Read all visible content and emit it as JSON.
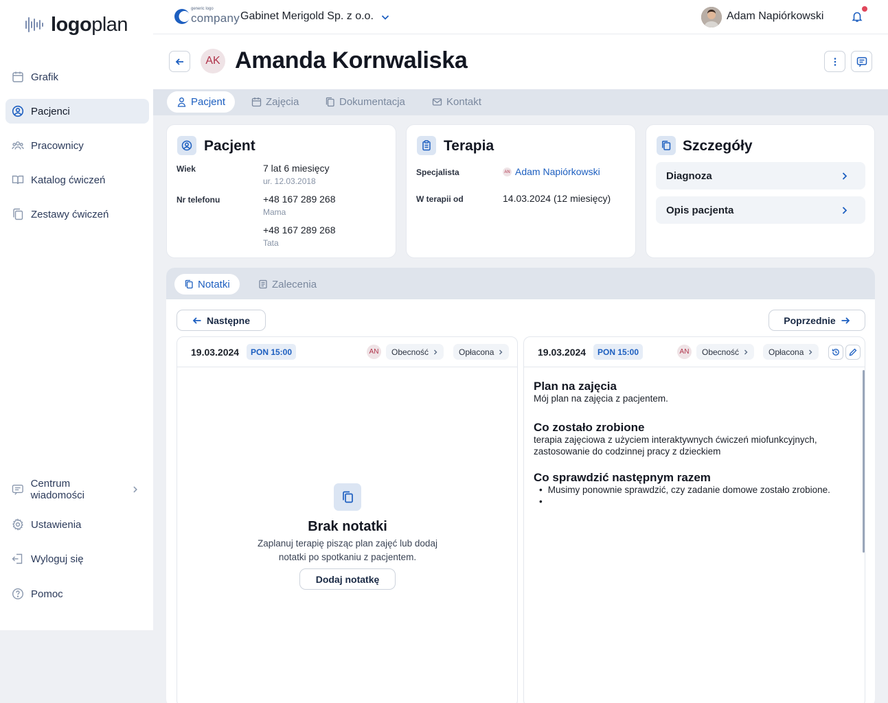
{
  "app": {
    "logo_bold": "logo",
    "logo_light": "plan"
  },
  "sidebar": {
    "items": [
      {
        "label": "Grafik",
        "icon": "calendar-icon"
      },
      {
        "label": "Pacjenci",
        "icon": "user-circle-icon",
        "active": true
      },
      {
        "label": "Pracownicy",
        "icon": "users-icon"
      },
      {
        "label": "Katalog ćwiczeń",
        "icon": "book-icon"
      },
      {
        "label": "Zestawy ćwiczeń",
        "icon": "copy-icon"
      }
    ],
    "bottom": [
      {
        "label": "Centrum wiadomości",
        "icon": "message-icon"
      },
      {
        "label": "Ustawienia",
        "icon": "gear-icon"
      },
      {
        "label": "Wyloguj się",
        "icon": "logout-icon"
      },
      {
        "label": "Pomoc",
        "icon": "help-icon"
      }
    ]
  },
  "topbar": {
    "company_logo_small": "generic logo",
    "company_logo_text": "company",
    "company_name": "Gabinet Merigold Sp. z o.o.",
    "user_name": "Adam Napiórkowski"
  },
  "header": {
    "patient_initials": "AK",
    "patient_name": "Amanda Kornwaliska"
  },
  "tabs": [
    {
      "label": "Pacjent",
      "active": true
    },
    {
      "label": "Zajęcia"
    },
    {
      "label": "Dokumentacja"
    },
    {
      "label": "Kontakt"
    }
  ],
  "patient_card": {
    "title": "Pacjent",
    "age_label": "Wiek",
    "age_value": "7 lat  6 miesięcy",
    "birth": "ur. 12.03.2018",
    "phone_label": "Nr telefonu",
    "phones": [
      {
        "number": "+48 167 289 268",
        "note": "Mama"
      },
      {
        "number": "+48 167 289 268",
        "note": "Tata"
      }
    ]
  },
  "therapy_card": {
    "title": "Terapia",
    "specialist_label": "Specjalista",
    "specialist_initials": "AN",
    "specialist_name": "Adam Napiórkowski",
    "since_label": "W terapii od",
    "since_value": "14.03.2024 (12 miesięcy)"
  },
  "details_card": {
    "title": "Szczegóły",
    "rows": [
      "Diagnoza",
      "Opis pacjenta"
    ]
  },
  "notes": {
    "tabs": [
      {
        "label": "Notatki",
        "active": true
      },
      {
        "label": "Zalecenia"
      }
    ],
    "next_label": "Następne",
    "prev_label": "Poprzednie",
    "left": {
      "date": "19.03.2024",
      "time": "PON 15:00",
      "initials": "AN",
      "presence": "Obecność",
      "payment": "Opłacona",
      "empty_title": "Brak notatki",
      "empty_desc": "Zaplanuj terapię pisząc plan zajęć lub dodaj notatki po spotkaniu z pacjentem.",
      "add_label": "Dodaj notatkę"
    },
    "right": {
      "date": "19.03.2024",
      "time": "PON 15:00",
      "initials": "AN",
      "presence": "Obecność",
      "payment": "Opłacona",
      "sections": [
        {
          "heading": "Plan na zajęcia",
          "text": "Mój plan na zajęcia z pacjentem."
        },
        {
          "heading": "Co zostało zrobione",
          "text": "terapia zajęciowa z użyciem interaktywnych ćwiczeń miofunkcyjnych, zastosowanie do codzinnej pracy z dzieckiem"
        },
        {
          "heading": "Co sprawdzić następnym razem",
          "bullets": [
            "Musimy ponownie sprawdzić, czy zadanie domowe zostało zrobione.",
            ""
          ]
        }
      ]
    }
  },
  "colors": {
    "accent": "#1d5fc0",
    "avatar_text": "#b0334a",
    "notification": "#e0475b"
  }
}
